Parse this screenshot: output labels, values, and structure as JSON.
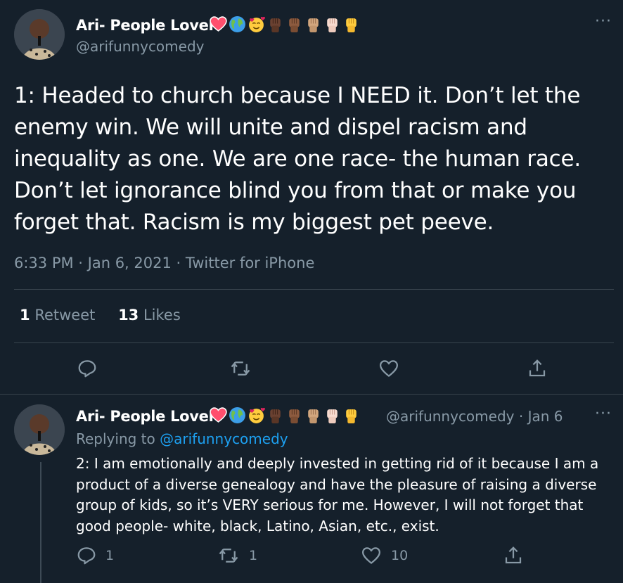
{
  "main_tweet": {
    "author_name": "Ari- People Lover",
    "handle": "@arifunnycomedy",
    "name_emojis": [
      "heart-emoji",
      "globe-emoji",
      "smiling-face-with-hearts-emoji",
      "raised-fist-dark-skin-emoji",
      "raised-fist-medium-dark-skin-emoji",
      "raised-fist-medium-skin-emoji",
      "raised-fist-light-skin-emoji",
      "raised-fist-yellow-emoji"
    ],
    "text": "1: Headed to church because I NEED it. Don’t let the enemy win. We will unite and dispel racism and inequality as one. We are one race- the human race. Don’t let ignorance blind you from that or make you forget that. Racism is my biggest pet peeve.",
    "meta": "6:33 PM · Jan 6, 2021 · Twitter for iPhone",
    "retweet_count": "1",
    "retweet_label": "Retweet",
    "like_count": "13",
    "like_label": "Likes",
    "actions": [
      "reply-icon",
      "retweet-icon",
      "like-icon",
      "share-icon"
    ]
  },
  "reply_tweet": {
    "author_name": "Ari- People Lover",
    "handle_date": "@arifunnycomedy · Jan 6",
    "replying_prefix": "Replying to",
    "replying_to": "@arifunnycomedy",
    "text": "2: I am emotionally and deeply invested in getting rid of it because I am a product of a diverse genealogy and have the pleasure of raising a diverse group of kids, so it’s VERY serious for me. However, I will not forget that good people- white, black, Latino, Asian, etc., exist.",
    "reply_count": "1",
    "retweet_count": "1",
    "like_count": "10"
  },
  "colors": {
    "background": "#15202b",
    "text_primary": "#ffffff",
    "text_secondary": "#8899a6",
    "link": "#1da1f2",
    "divider": "#38444d"
  }
}
